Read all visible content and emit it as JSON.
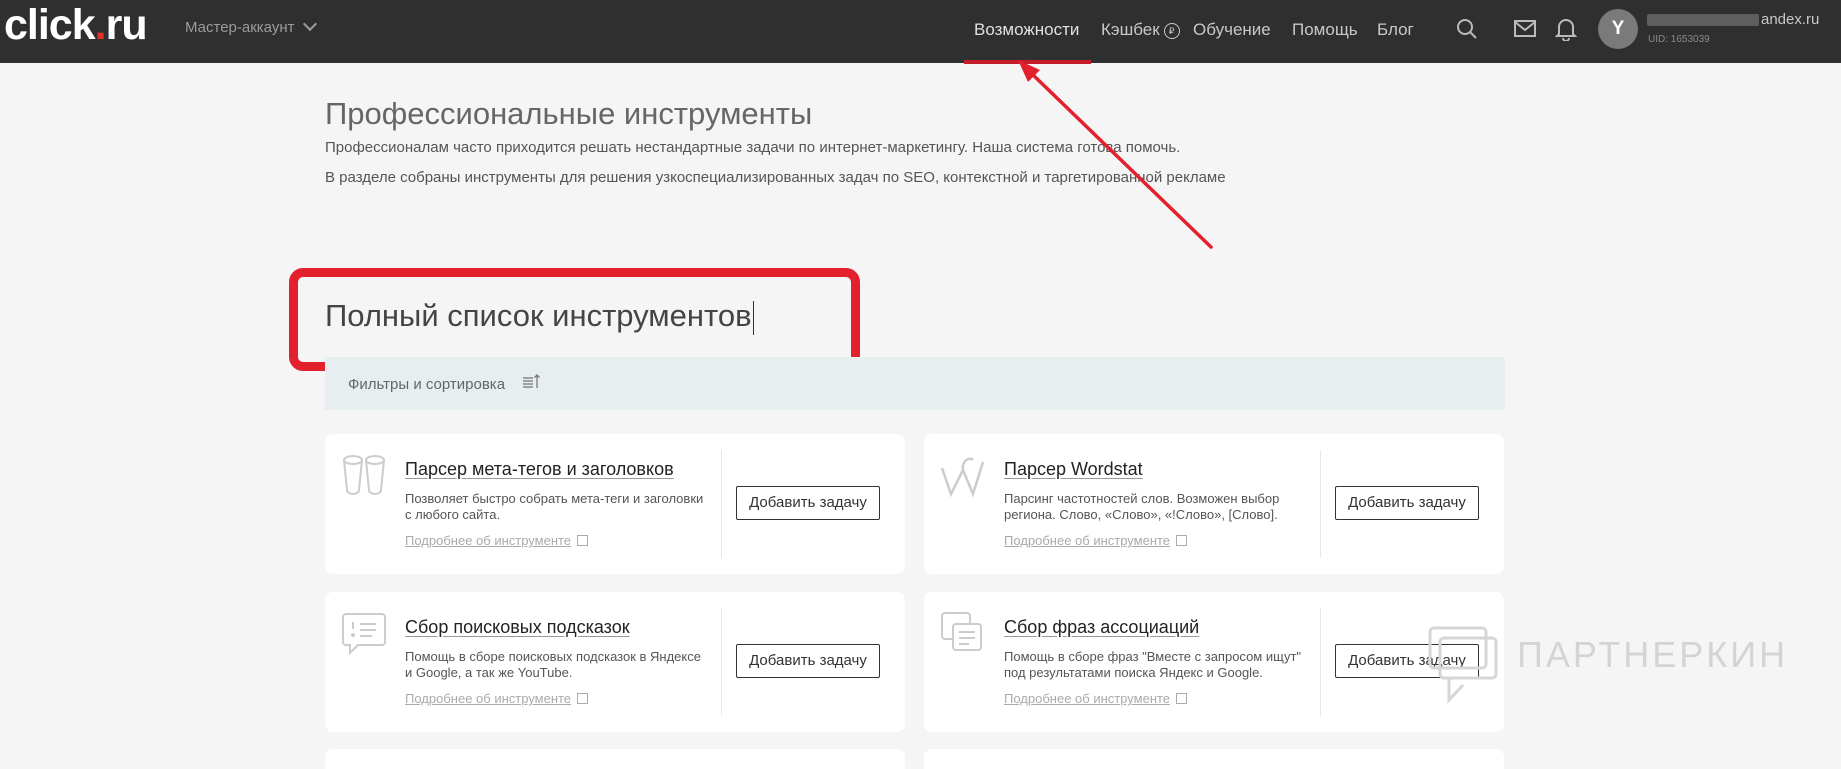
{
  "header": {
    "logo": {
      "main": "click",
      "dot": ".",
      "tld": "ru"
    },
    "account_label": "Мастер-аккаунт",
    "nav": [
      {
        "label": "Возможности"
      },
      {
        "label": "Кэшбек"
      },
      {
        "label": "Обучение"
      },
      {
        "label": "Помощь"
      },
      {
        "label": "Блог"
      }
    ],
    "icons": [
      "search-icon",
      "mail-icon",
      "bell-icon"
    ],
    "user": {
      "avatar_letter": "Y",
      "email_visible": "andex.ru",
      "uid": "UID: 1653039"
    }
  },
  "intro": {
    "title": "Профессиональные инструменты",
    "desc1": "Профессионалам часто приходится решать нестандартные задачи по интернет-маркетингу. Наша система готова помочь.",
    "desc2": "В разделе собраны инструменты для решения узкоспециализированных задач по SEO, контекстной и таргетированной рекламе"
  },
  "section": {
    "title": "Полный список инструментов",
    "filter_label": "Фильтры и сортировка"
  },
  "cards": [
    {
      "title": "Парсер мета-тегов и заголовков",
      "desc": "Позволяет быстро собрать мета-теги и заголовки с любого сайта.",
      "more": "Подробнее об инструменте",
      "button": "Добавить задачу",
      "icon": "binoculars-icon"
    },
    {
      "title": "Парсер Wordstat",
      "desc": "Парсинг частотностей слов. Возможен выбор региона. Слово, «Слово», «!Слово», [Слово].",
      "more": "Подробнее об инструменте",
      "button": "Добавить задачу",
      "icon": "wordstat-icon"
    },
    {
      "title": "Сбор поисковых подсказок",
      "desc": "Помощь в сборе поисковых подсказок в Яндексе и Google, а так же YouTube.",
      "more": "Подробнее об инструменте",
      "button": "Добавить задачу",
      "icon": "chat-list-icon"
    },
    {
      "title": "Сбор фраз ассоциаций",
      "desc": "Помощь в сборе фраз \"Вместе с запросом ищут\" под результатами поиска Яндекс и Google.",
      "more": "Подробнее об инструменте",
      "button": "Добавить задачу",
      "icon": "documents-icon"
    }
  ],
  "watermark": "ПАРТНЕРКИН",
  "colors": {
    "topbar": "#2f2f2f",
    "accent_red": "#e3212d",
    "filter_bg": "#e7eef0",
    "page_bg": "#f5f5f5"
  }
}
